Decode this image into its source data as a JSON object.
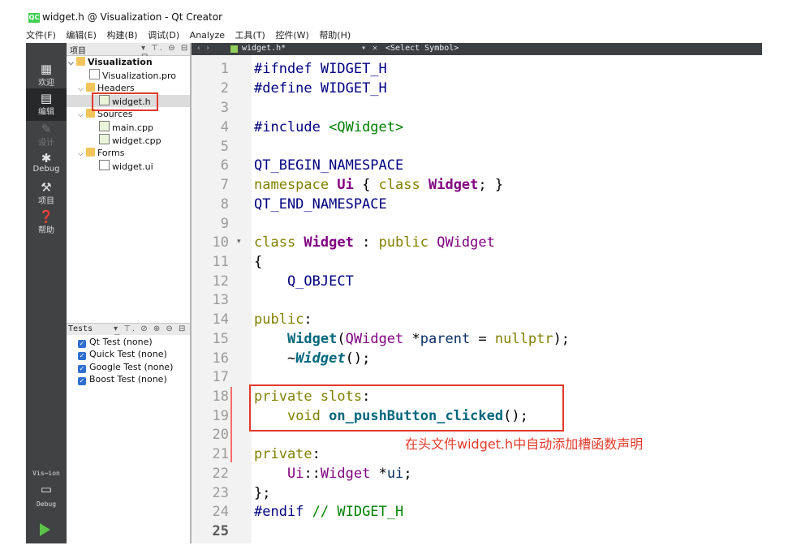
{
  "window": {
    "title": "widget.h @ Visualization - Qt Creator",
    "logo": "QC"
  },
  "menu": [
    "文件(F)",
    "编辑(E)",
    "构建(B)",
    "调试(D)",
    "Analyze",
    "工具(T)",
    "控件(W)",
    "帮助(H)"
  ],
  "modes": [
    {
      "label": "欢迎",
      "icon": "grid-icon"
    },
    {
      "label": "编辑",
      "icon": "edit-icon"
    },
    {
      "label": "设计",
      "icon": "design-icon"
    },
    {
      "label": "Debug",
      "icon": "bug-icon"
    },
    {
      "label": "项目",
      "icon": "wrench-icon"
    },
    {
      "label": "帮助",
      "icon": "help-icon"
    }
  ],
  "kit": {
    "project": "Vis⋯ion",
    "config": "Debug"
  },
  "project_panel": {
    "title": "项目",
    "root": "Visualization",
    "pro": "Visualization.pro",
    "headers": "Headers",
    "header_file": "widget.h",
    "sources": "Sources",
    "source_files": [
      "main.cpp",
      "widget.cpp"
    ],
    "forms": "Forms",
    "form_file": "widget.ui"
  },
  "tests_panel": {
    "title": "Tests",
    "items": [
      "Qt Test (none)",
      "Quick Test (none)",
      "Google Test (none)",
      "Boost Test (none)"
    ]
  },
  "editor": {
    "file_tab": "widget.h*",
    "symbol": "<Select Symbol>",
    "current_line": 25,
    "line_numbers": [
      "1",
      "2",
      "3",
      "4",
      "5",
      "6",
      "7",
      "8",
      "9",
      "10",
      "11",
      "12",
      "13",
      "14",
      "15",
      "16",
      "17",
      "18",
      "19",
      "20",
      "21",
      "22",
      "23",
      "24",
      "25"
    ]
  },
  "code": {
    "l1a": "#ifndef",
    "l1b": " WIDGET_H",
    "l2a": "#define",
    "l2b": " WIDGET_H",
    "l4a": "#include",
    "l4b": " <QWidget>",
    "l6": "QT_BEGIN_NAMESPACE",
    "l7a": "namespace",
    "l7b": " Ui",
    "l7c": " { ",
    "l7d": "class",
    "l7e": " Widget",
    "l7f": "; }",
    "l8": "QT_END_NAMESPACE",
    "l10a": "class",
    "l10b": " Widget",
    "l10c": " : ",
    "l10d": "public",
    "l10e": " QWidget",
    "l11": "{",
    "l12": "    Q_OBJECT",
    "l14a": "public",
    "l14b": ":",
    "l15a": "    ",
    "l15b": "Widget",
    "l15c": "(",
    "l15d": "QWidget",
    "l15e": " *",
    "l15f": "parent",
    "l15g": " = ",
    "l15h": "nullptr",
    "l15i": ");",
    "l16a": "    ~",
    "l16b": "Widget",
    "l16c": "();",
    "l18a": "private",
    "l18b": " ",
    "l18c": "slots",
    "l18d": ":",
    "l19a": "    ",
    "l19b": "void",
    "l19c": " ",
    "l19d": "on_pushButton_clicked",
    "l19e": "();",
    "l22a": "private",
    "l22b": ":",
    "l23a": "    ",
    "l23b": "Ui",
    "l23c": "::",
    "l23d": "Widget",
    "l23e": " *",
    "l23f": "ui",
    "l23g": ";",
    "l24": "};",
    "l25a": "#endif",
    "l25b": " // WIDGET_H"
  },
  "annotation": "在头文件widget.h中自动添加槽函数声明",
  "colors": {
    "annotation": "#e23a2b",
    "keyword": "#808000",
    "type": "#800080",
    "function": "#00677c",
    "sidebar": "#404244"
  }
}
